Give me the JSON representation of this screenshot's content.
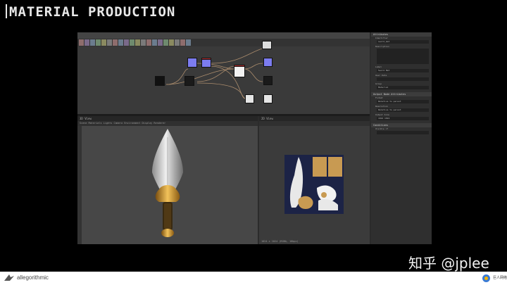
{
  "slide": {
    "title": "MATERIAL PRODUCTION"
  },
  "app": {
    "graph_swatches": [
      "#8e6d6d",
      "#7a6a8a",
      "#6b7c8e",
      "#6e8a6e",
      "#8a8a60",
      "#7a7a7a",
      "#8e6d6d",
      "#6b7c8e",
      "#7a6a8a",
      "#6e8a6e",
      "#8a8a60",
      "#7a7a7a",
      "#8e6d6d",
      "#6b7c8e",
      "#7a6a8a",
      "#6e8a6e",
      "#8a8a60",
      "#7a7a7a",
      "#8e6d6d",
      "#6b7c8e"
    ],
    "view3d": {
      "title": "3D View",
      "menu": "Scene   Materials   Lights   Camera   Environment   Display   Renderer"
    },
    "view2d": {
      "title": "2D View",
      "status": "1024 x 1024 (RGBA, 16bpc)"
    },
    "properties": {
      "header": "Attributes",
      "fields": [
        {
          "label": "Identifier",
          "value": "sword_mat"
        },
        {
          "label": "Description",
          "value": ""
        },
        {
          "label": "Label",
          "value": "Sword Mat"
        },
        {
          "label": "User Data",
          "value": ""
        },
        {
          "label": "Group",
          "value": "Material"
        }
      ],
      "section2": "Output Node Attributes",
      "fields2": [
        {
          "label": "Format",
          "value": "Relative to parent"
        },
        {
          "label": "Resolution",
          "value": "Relative to parent"
        },
        {
          "label": "Output Size",
          "value": "1024    1024"
        }
      ],
      "section3": "Conditions",
      "fields3": [
        {
          "label": "Visible if",
          "value": ""
        }
      ]
    }
  },
  "watermark": "知乎 @jplee",
  "footer": {
    "brand_left": "allegorithmic",
    "brand_right": "巨人网络"
  }
}
